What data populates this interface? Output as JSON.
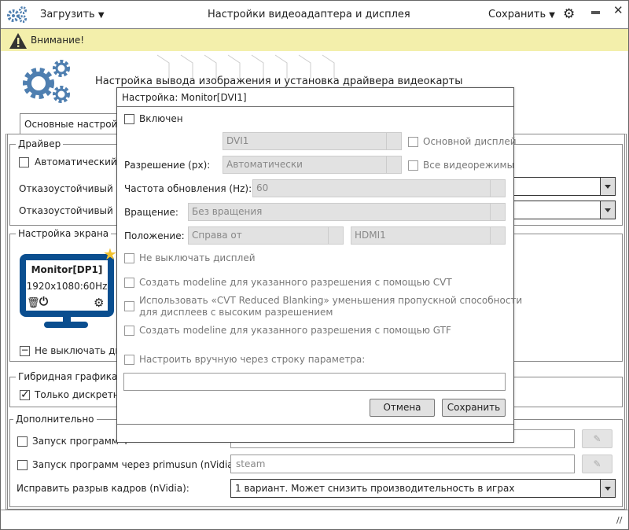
{
  "titlebar": {
    "title": "Настройки видеоадаптера и дисплея",
    "load_label": "Загрузить",
    "save_label": "Сохранить"
  },
  "warning": {
    "text": "Внимание!"
  },
  "header": {
    "heading": "Настройка вывода изображения и установка драйвера видеокарты"
  },
  "tabs": [
    {
      "label": "Основные настройки",
      "active": true
    }
  ],
  "driver": {
    "title": "Драйвер",
    "auto_checkbox": "Автоматический в",
    "fallback1": "Отказоустойчивый др",
    "fallback2": "Отказоустойчивый др"
  },
  "screen": {
    "title": "Настройка экрана",
    "monitor_name": "Monitor[DP1]",
    "monitor_mode": "1920x1080:60Hz",
    "no_sleep": "Не выключать ди",
    "monitor_color": "#0a4e8f",
    "star_color": "#f2c230"
  },
  "hybrid": {
    "title": "Гибридная графика",
    "discrete_only": "Только дискретн",
    "discrete_checked": true
  },
  "extra": {
    "title": "Дополнительно",
    "row1_label": "Запуск программ ч",
    "row1_value": "",
    "row2_label": "Запуск программ через primusun (nVidia):",
    "row2_value": "steam",
    "tearing_label": "Исправить разрыв кадров (nVidia):",
    "tearing_value": "1 вариант. Может снизить производительность в играх"
  },
  "dialog": {
    "title": "Настройка: Monitor[DVI1]",
    "enabled": "Включен",
    "output_value": "DVI1",
    "primary_display": "Основной дисплей",
    "resolution_label": "Разрешение (px):",
    "resolution_value": "Автоматически",
    "all_modes": "Все видеорежимы",
    "refresh_label": "Частота обновления (Hz):",
    "refresh_value": "60",
    "rotation_label": "Вращение:",
    "rotation_value": "Без вращения",
    "position_label": "Положение:",
    "position_value": "Справа от",
    "position_target": "HDMI1",
    "no_sleep": "Не выключать дисплей",
    "cvt": "Создать modeline для указанного разрешения с помощью CVT",
    "cvt_rb_line1": "Использовать «CVT Reduced Blanking» уменьшения пропускной способности",
    "cvt_rb_line2": "для дисплеев с высоким разрешением",
    "gtf": "Создать modeline для указанного разрешения с помощью GTF",
    "manual": "Настроить вручную через строку параметра:",
    "manual_value": "",
    "cancel": "Отмена",
    "save": "Сохранить"
  },
  "colors": {
    "accent": "#4f7fb0",
    "warning_bg": "#f3efab"
  }
}
